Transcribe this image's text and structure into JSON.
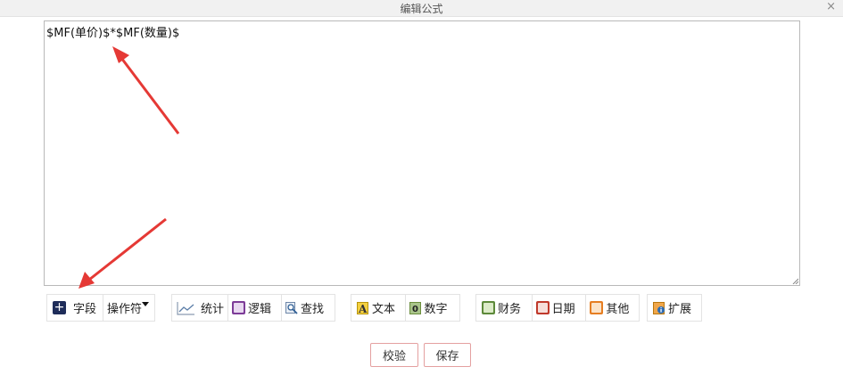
{
  "dialog": {
    "title": "编辑公式",
    "close_symbol": "×"
  },
  "editor": {
    "value": "$MF(单价)$*$MF(数量)$"
  },
  "toolbar": {
    "field_label": "字段",
    "operator_label": "操作符",
    "stats_label": "统计",
    "logic_label": "逻辑",
    "lookup_label": "查找",
    "text_label": "文本",
    "number_label": "数字",
    "finance_label": "财务",
    "date_label": "日期",
    "other_label": "其他",
    "extend_label": "扩展"
  },
  "footer": {
    "validate_label": "校验",
    "save_label": "保存"
  },
  "colors": {
    "annotation_arrow": "#e53935",
    "footer_button_border": "#e4a0a0",
    "field_icon": "#1f2d5a"
  },
  "icons": {
    "field": "plus-square-icon",
    "stats": "line-chart-icon",
    "logic": "purple-book-icon",
    "lookup": "magnifier-icon",
    "text": "text-a-icon",
    "number": "number-icon",
    "finance": "green-book-icon",
    "date": "calendar-book-icon",
    "other": "orange-book-icon",
    "extend": "info-book-icon"
  }
}
